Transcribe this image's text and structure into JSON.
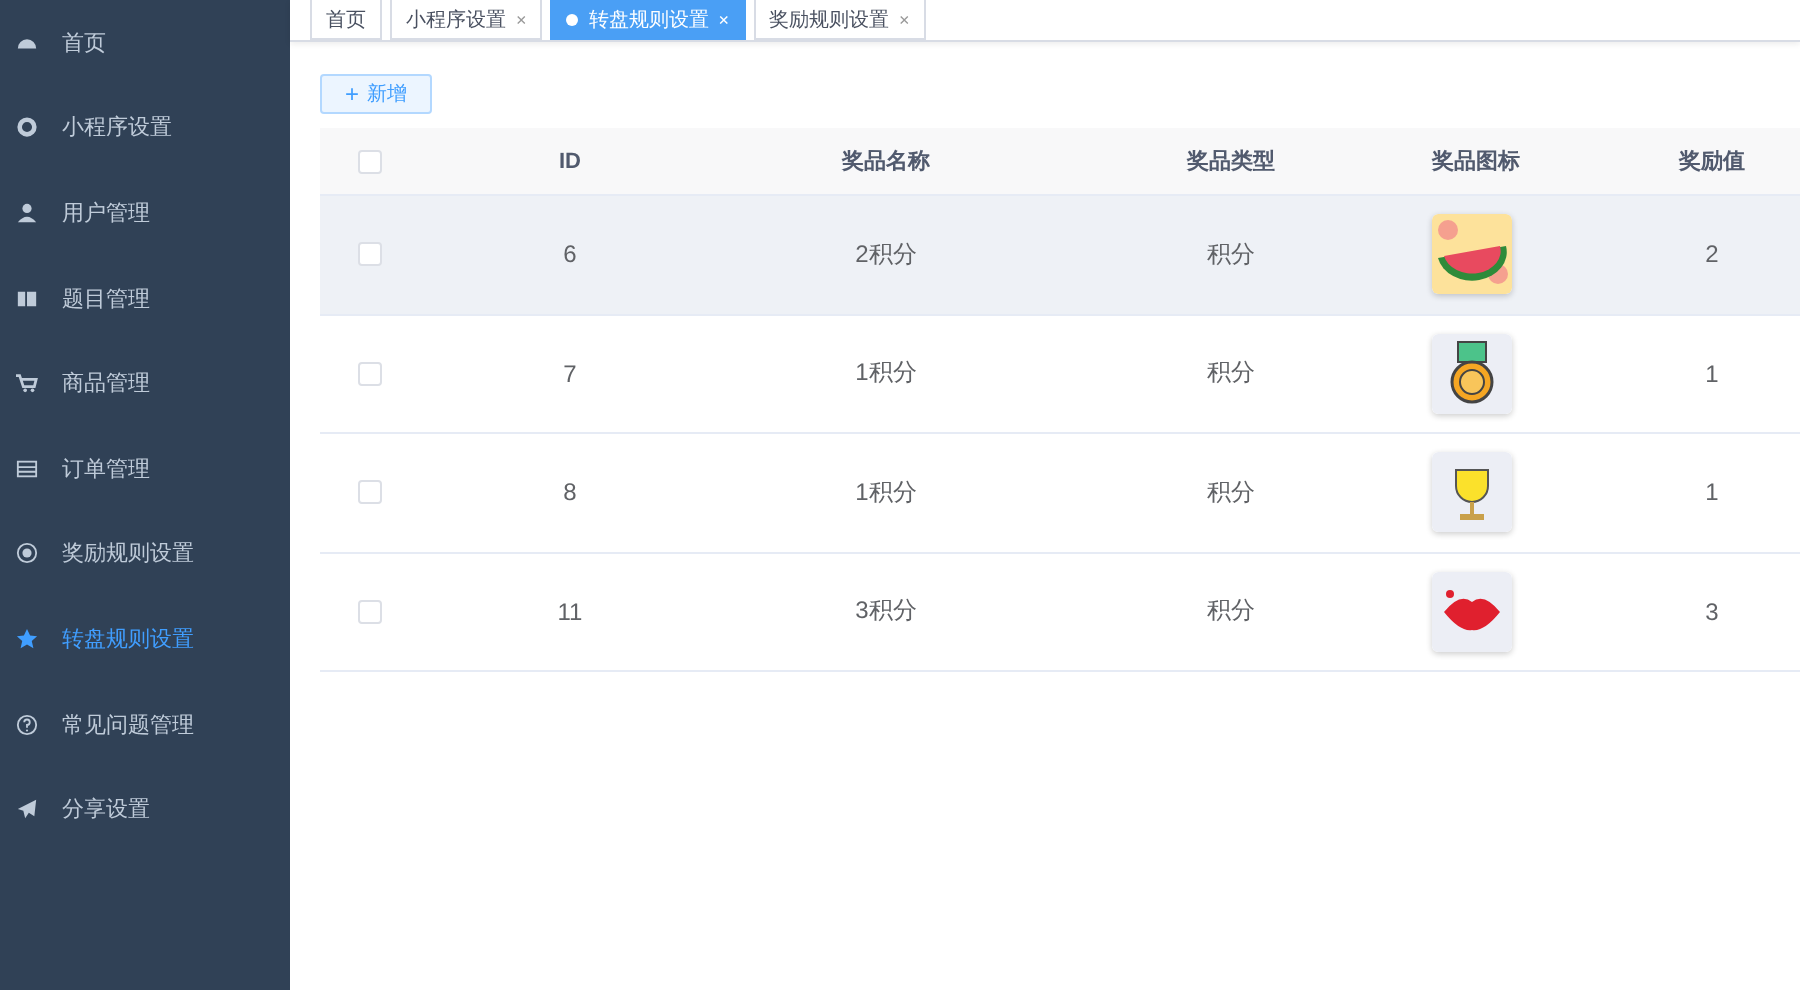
{
  "sidebar": {
    "items": [
      {
        "label": "首页",
        "selected": false
      },
      {
        "label": "小程序设置",
        "selected": false
      },
      {
        "label": "用户管理",
        "selected": false
      },
      {
        "label": "题目管理",
        "selected": false
      },
      {
        "label": "商品管理",
        "selected": false
      },
      {
        "label": "订单管理",
        "selected": false
      },
      {
        "label": "奖励规则设置",
        "selected": false
      },
      {
        "label": "转盘规则设置",
        "selected": true
      },
      {
        "label": "常见问题管理",
        "selected": false
      },
      {
        "label": "分享设置",
        "selected": false
      }
    ]
  },
  "tabs": [
    {
      "label": "首页",
      "closable": false,
      "selected": false
    },
    {
      "label": "小程序设置",
      "closable": true,
      "selected": false
    },
    {
      "label": "转盘规则设置",
      "closable": true,
      "selected": true
    },
    {
      "label": "奖励规则设置",
      "closable": true,
      "selected": false
    }
  ],
  "close_glyph": "×",
  "add_button": {
    "icon": "+",
    "label": "新增"
  },
  "table": {
    "select_all_checked": false,
    "columns": [
      "ID",
      "奖品名称",
      "奖品类型",
      "奖品图标",
      "奖励值"
    ],
    "rows": [
      {
        "checked": false,
        "highlighted": true,
        "id": "6",
        "name": "2积分",
        "type": "积分",
        "value": "2"
      },
      {
        "checked": false,
        "highlighted": false,
        "id": "7",
        "name": "1积分",
        "type": "积分",
        "value": "1"
      },
      {
        "checked": false,
        "highlighted": false,
        "id": "8",
        "name": "1积分",
        "type": "积分",
        "value": "1"
      },
      {
        "checked": false,
        "highlighted": false,
        "id": "11",
        "name": "3积分",
        "type": "积分",
        "value": "3"
      }
    ]
  }
}
